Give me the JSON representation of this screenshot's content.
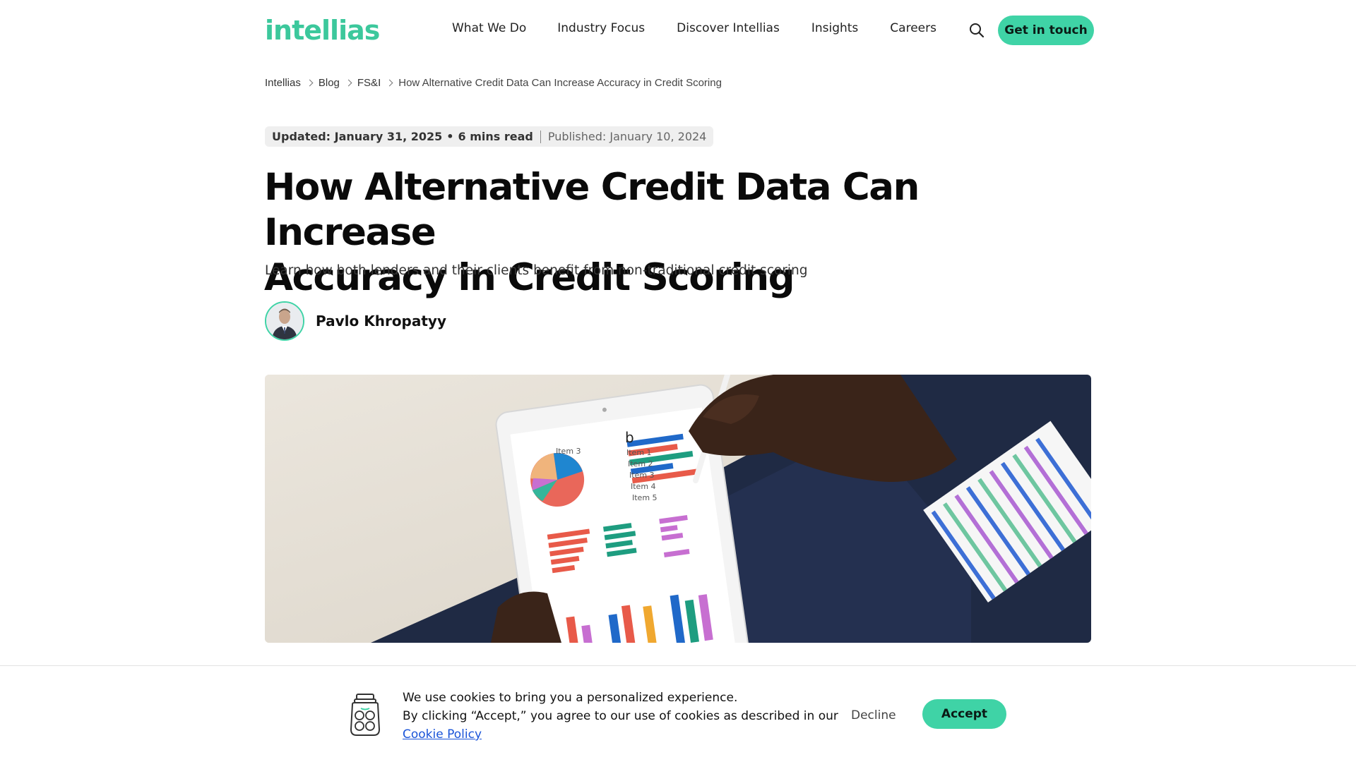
{
  "header": {
    "logo_text": "intellias",
    "nav": [
      "What We Do",
      "Industry Focus",
      "Discover Intellias",
      "Insights",
      "Careers"
    ],
    "cta_label": "Get in touch",
    "search_icon": "search-icon",
    "brand_color": "#3fd3a6"
  },
  "breadcrumb": [
    "Intellias",
    "Blog",
    "FS&I",
    "How Alternative Credit Data Can Increase Accuracy in Credit Scoring"
  ],
  "meta": {
    "updated": "Updated: January 31, 2025",
    "read_time": "6 mins read",
    "published": "Published: January 10, 2024"
  },
  "article": {
    "title_line1": "How Alternative Credit Data Can Increase",
    "title_line2": "Accuracy in Credit Scoring",
    "subtitle": "Learn how both lenders and their clients benefit from non-traditional credit scoring",
    "author": "Pavlo Khropatyy"
  },
  "cookie": {
    "line1": "We use cookies to bring you a personalized experience.",
    "line2": "By clicking “Accept,” you agree to our use of cookies as described in our",
    "link": "Cookie Policy",
    "decline": "Decline",
    "accept": "Accept",
    "icon": "cookie-jar-icon"
  },
  "hero_chart_labels": {
    "items": [
      "Item 1",
      "Item 2",
      "Item 3",
      "Item 4",
      "Item 5"
    ],
    "pie_label": "Item 3",
    "panel_letter": "b"
  }
}
